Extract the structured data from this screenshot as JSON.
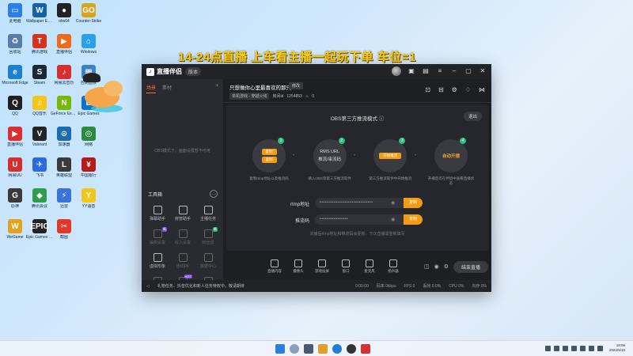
{
  "desktop": {
    "banner": "14-24点直播   上车看主播一起玩下单 车位=1",
    "icons": [
      {
        "label": "此电脑",
        "color": "#2b7de9",
        "glyph": "▭"
      },
      {
        "label": "Wallpaper Engine",
        "color": "#1463a8",
        "glyph": "W"
      },
      {
        "label": "obs64",
        "color": "#222222",
        "glyph": "●"
      },
      {
        "label": "Counter-Strike",
        "color": "#d9a521",
        "glyph": "GO"
      },
      {
        "label": "回收站",
        "color": "#5a7ca8",
        "glyph": "♻"
      },
      {
        "label": "腾讯游戏",
        "color": "#d8321c",
        "glyph": "T"
      },
      {
        "label": "直播伴侣",
        "color": "#ee6a1d",
        "glyph": "▶"
      },
      {
        "label": "Windows",
        "color": "#2aa0e8",
        "glyph": "⌂"
      },
      {
        "label": "Microsoft Edge",
        "color": "#1b7fd2",
        "glyph": "e"
      },
      {
        "label": "Steam",
        "color": "#1b2838",
        "glyph": "S"
      },
      {
        "label": "网易云音乐",
        "color": "#d62f2f",
        "glyph": "♪"
      },
      {
        "label": "控制面板",
        "color": "#3c82c8",
        "glyph": "▦"
      },
      {
        "label": "QQ",
        "color": "#1f1f1f",
        "glyph": "Q"
      },
      {
        "label": "QQ音乐",
        "color": "#f5c518",
        "glyph": "♫"
      },
      {
        "label": "GeForce Experience",
        "color": "#76b900",
        "glyph": "N"
      },
      {
        "label": "Epic Games",
        "color": "#0d73d3",
        "glyph": "E"
      },
      {
        "label": "直播伴侣",
        "color": "#d92f2f",
        "glyph": "▶"
      },
      {
        "label": "Valorant",
        "color": "#242424",
        "glyph": "V"
      },
      {
        "label": "加速器",
        "color": "#1a6bb0",
        "glyph": "⊙"
      },
      {
        "label": "网络",
        "color": "#2d8a3e",
        "glyph": "◎"
      },
      {
        "label": "网易UU",
        "color": "#d52e2e",
        "glyph": "U"
      },
      {
        "label": "飞书",
        "color": "#2a6be0",
        "glyph": "✈"
      },
      {
        "label": "英雄联盟",
        "color": "#3a3a3a",
        "glyph": "L"
      },
      {
        "label": "中国银行",
        "color": "#b51b1b",
        "glyph": "¥"
      },
      {
        "label": "原神",
        "color": "#3a3a3a",
        "glyph": "G"
      },
      {
        "label": "腾讯会议",
        "color": "#2c9e4a",
        "glyph": "◆"
      },
      {
        "label": "迅雷",
        "color": "#3b74d8",
        "glyph": "⚡"
      },
      {
        "label": "YY语音",
        "color": "#f2c71b",
        "glyph": "Y"
      },
      {
        "label": "WeGame",
        "color": "#e5a21f",
        "glyph": "W"
      },
      {
        "label": "Epic Games Launcher",
        "color": "#222222",
        "glyph": "EPIC"
      },
      {
        "label": "截图",
        "color": "#e2382c",
        "glyph": "✂"
      }
    ]
  },
  "app": {
    "title": "直播伴侣",
    "version": "版本",
    "sidebar": {
      "tabs": [
        "场景",
        "素材",
        "+"
      ],
      "empty_text": "OBS模式下，画面设置暂不可用",
      "tools_heading": "工具箱",
      "tools": [
        {
          "label": "弹幕助手",
          "dim": false,
          "tag": ""
        },
        {
          "label": "房管助手",
          "dim": false,
          "tag": ""
        },
        {
          "label": "主播任务",
          "dim": false,
          "tag": ""
        },
        {
          "label": "抽奖设置",
          "dim": true,
          "tag": "新"
        },
        {
          "label": "收入设置",
          "dim": true,
          "tag": ""
        },
        {
          "label": "粉丝团",
          "dim": true,
          "tag": "新"
        },
        {
          "label": "虚拟形象",
          "dim": false,
          "tag": ""
        },
        {
          "label": "连线PK",
          "dim": true,
          "tag": ""
        },
        {
          "label": "数据中心",
          "dim": true,
          "tag": ""
        },
        {
          "label": "更多",
          "dim": true,
          "tag": ""
        },
        {
          "label": "活动",
          "dim": true,
          "tag": "HOT"
        },
        {
          "label": "设置",
          "dim": true,
          "tag": ""
        }
      ]
    },
    "room": {
      "title": "只想做你心里最喜欢的那只!",
      "edit": "修改",
      "category": "单机游戏 · 穿越火线",
      "meta_label": "房间id",
      "room_id": "1254853",
      "likes": "0"
    },
    "stage": {
      "title": "OBS第三方推流模式",
      "exit": "退出",
      "steps": [
        {
          "num": "1",
          "lines": [
            "复制",
            "复制"
          ],
          "desc": "复制rtmp地址以及推流码"
        },
        {
          "num": "2",
          "lines": [
            "RMS URL",
            "推流/串流码"
          ],
          "desc": "填入OBS等第三方推流软件"
        },
        {
          "num": "3",
          "lines": [
            "开始推流"
          ],
          "desc": "第三方推流软件中开始推流"
        },
        {
          "num": "4",
          "lines": [
            "自动开播"
          ],
          "desc": "开播后可在伴侣中查看直播状态"
        }
      ],
      "rtmp_label": "rtmp地址",
      "rtmp_value": "••••••••••••••••••••••••••••••",
      "key_label": "推流码",
      "key_value": "••••••••••••••••",
      "copy": "复制",
      "hint": "关播后rtmp地址和推流码会更新，下次直播需重新填写"
    },
    "bottom_bar": [
      {
        "label": "直播内容"
      },
      {
        "label": "摄像头"
      },
      {
        "label": "游戏投屏"
      },
      {
        "label": "窗口"
      },
      {
        "label": "麦克风"
      },
      {
        "label": "扬声器"
      }
    ],
    "live_button": "结束直播",
    "status": {
      "notice": "礼物任务、抖音优化和新人任务特权中，敬请期待",
      "items": [
        "0:00:00",
        "码率 0kbps",
        "FPS 0",
        "丢帧 0.0%",
        "CPU 0%",
        "内存 0%"
      ]
    }
  },
  "taskbar": {
    "time": "19:06",
    "date": "2022/5/10"
  }
}
